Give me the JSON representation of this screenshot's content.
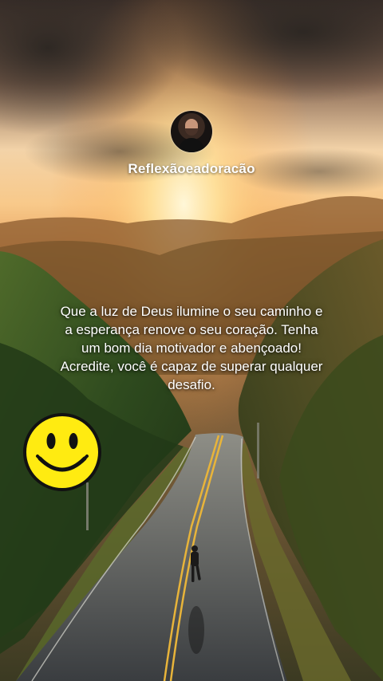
{
  "account": {
    "username": "Reflexãoeadoracão"
  },
  "post": {
    "quote": "Que a luz de Deus ilumine o seu caminho e a esperança renove o seu coração. Tenha um bom dia motivador e abençoado! Acredite, você é capaz de superar qualquer desafio."
  },
  "icons": {
    "smiley": "smiley-face-icon"
  },
  "colors": {
    "sky_glow": "#ffe9a8",
    "smiley_yellow": "#ffeb11",
    "road_line": "#e8b43a"
  }
}
